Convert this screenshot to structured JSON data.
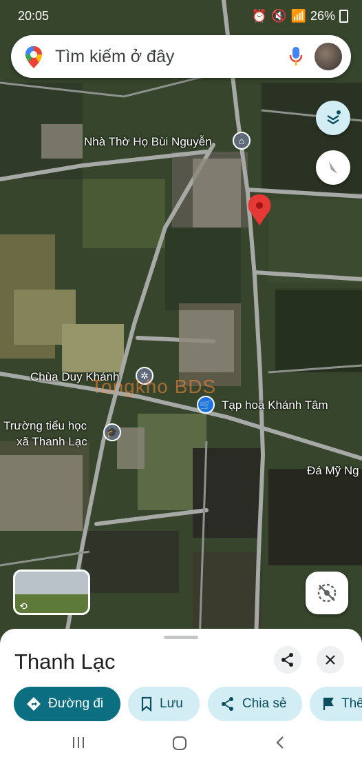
{
  "status": {
    "time": "20:05",
    "battery": "26%"
  },
  "search": {
    "placeholder": "Tìm kiếm ở đây"
  },
  "map": {
    "labels": {
      "church_bui_nguyen": "Nhà Thờ Họ Bùi Nguyễn",
      "chua_duy_khanh": "Chùa Duy Khánh",
      "tap_hoa": "Tạp hoá Khánh Tâm",
      "school_line1": "Trường tiểu học",
      "school_line2": "xã Thanh Lạc",
      "da_my": "Đá Mỹ Ng"
    },
    "watermark": "Tongkho BDS"
  },
  "sheet": {
    "title": "Thanh Lạc",
    "actions": {
      "directions": "Đường đi",
      "save": "Lưu",
      "share": "Chia sẻ",
      "more": "Thê"
    }
  },
  "colors": {
    "primary": "#0b6e81",
    "secondary_chip": "#d3edf5",
    "pin": "#e53935"
  }
}
